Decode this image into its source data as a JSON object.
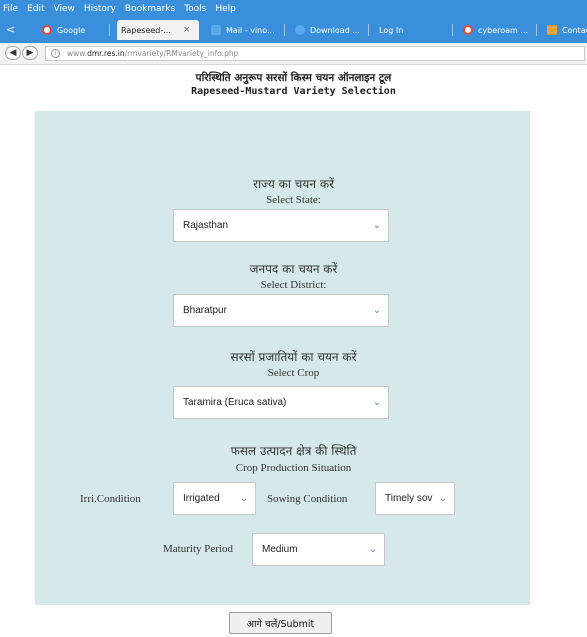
{
  "browser": {
    "menu": [
      "File",
      "Edit",
      "View",
      "History",
      "Bookmarks",
      "Tools",
      "Help"
    ],
    "tabs": [
      {
        "label": "Google",
        "color": "#ffffff"
      },
      {
        "label": "Rapeseed-...",
        "close": "×"
      },
      {
        "label": "Mail - vino...",
        "color": "#5aa9ec"
      },
      {
        "label": "Download ...",
        "color": "#5aa9ec"
      },
      {
        "label": "Log In"
      },
      {
        "label": "cyberoam ...",
        "color": "#ffffff"
      },
      {
        "label": "Contact"
      }
    ],
    "back_glyph": "<",
    "url_prefix": "www.",
    "url_domain": "dmr.res.in",
    "url_path": "/rmvariety/RMvariety_info.php"
  },
  "page": {
    "title_hindi": "परिस्थिति अनुरूप सरसों किस्म चयन ऑनलाइन टूल",
    "title_english": "Rapeseed-Mustard Variety Selection",
    "state": {
      "label_hindi": "राज्य का चयन करें",
      "label_english": "Select State:",
      "value": "Rajasthan"
    },
    "district": {
      "label_hindi": "जनपद का चयन करें",
      "label_english": "Select District:",
      "value": "Bharatpur"
    },
    "crop": {
      "label_hindi": "सरसों प्रजातियों का चयन करें",
      "label_english": "Select Crop",
      "value": "Taramira (Eruca sativa)"
    },
    "production": {
      "label_hindi": "फसल उत्पादन क्षेत्र की स्थिति",
      "label_english": "Crop Production Situation"
    },
    "irri": {
      "label": "Irri.Condition",
      "value": "Irrigated"
    },
    "sowing": {
      "label": "Sowing Condition",
      "value": "Timely sov"
    },
    "maturity": {
      "label": "Maturity Period",
      "value": "Medium"
    },
    "submit_label": "आगे चलें/Submit"
  },
  "colors": {
    "chrome_blue": "#3a8fdc",
    "panel_bg": "#d6e9ea",
    "dropdown_arrow": "#5a84c0"
  }
}
